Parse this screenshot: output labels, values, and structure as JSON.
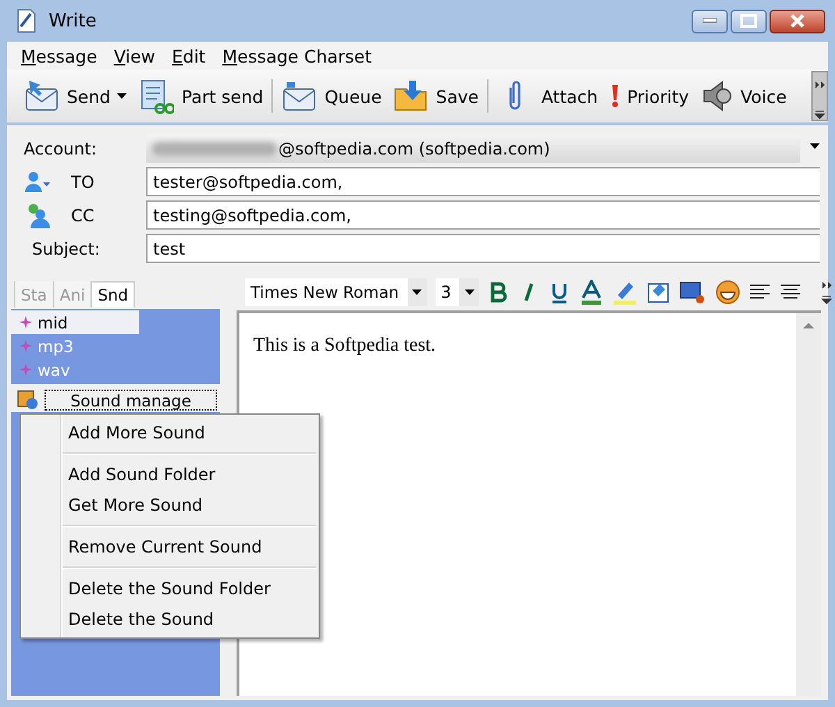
{
  "window": {
    "title": "Write"
  },
  "menu_bar": [
    "Message",
    "View",
    "Edit",
    "Message Charset"
  ],
  "toolbar": [
    {
      "kind": "send",
      "label": "Send",
      "dropdown": true
    },
    {
      "kind": "part-send",
      "label": "Part send",
      "dropdown": false
    },
    {
      "kind": "queue",
      "label": "Queue",
      "dropdown": false
    },
    {
      "kind": "save",
      "label": "Save",
      "dropdown": false
    },
    {
      "kind": "attach",
      "label": "Attach",
      "dropdown": false
    },
    {
      "kind": "priority",
      "label": "Priority",
      "dropdown": false
    },
    {
      "kind": "voice",
      "label": "Voice",
      "dropdown": false
    }
  ],
  "header": {
    "account": {
      "label": "Account:",
      "value": "@softpedia.com  (softpedia.com)"
    },
    "to": {
      "label": "TO",
      "value": "tester@softpedia.com,"
    },
    "cc": {
      "label": "CC",
      "value": "testing@softpedia.com,"
    },
    "subject": {
      "label": "Subject:",
      "value": "test"
    }
  },
  "side_tabs": [
    {
      "label": "Sta",
      "selected": false
    },
    {
      "label": "Ani",
      "selected": false
    },
    {
      "label": "Snd",
      "selected": true
    }
  ],
  "sound_list": [
    {
      "label": "mid",
      "selected": true
    },
    {
      "label": "mp3",
      "selected": false
    },
    {
      "label": "wav",
      "selected": false
    }
  ],
  "sound_manage_button": "Sound manage",
  "format_bar": {
    "font": "Times New Roman",
    "size": "3"
  },
  "editor": {
    "text": "This is a Softpedia test."
  },
  "context_menu": [
    [
      "Add More Sound"
    ],
    [
      "Add Sound Folder",
      "Get More Sound"
    ],
    [
      "Remove Current Sound"
    ],
    [
      "Delete the Sound Folder",
      "Delete the Sound"
    ]
  ]
}
